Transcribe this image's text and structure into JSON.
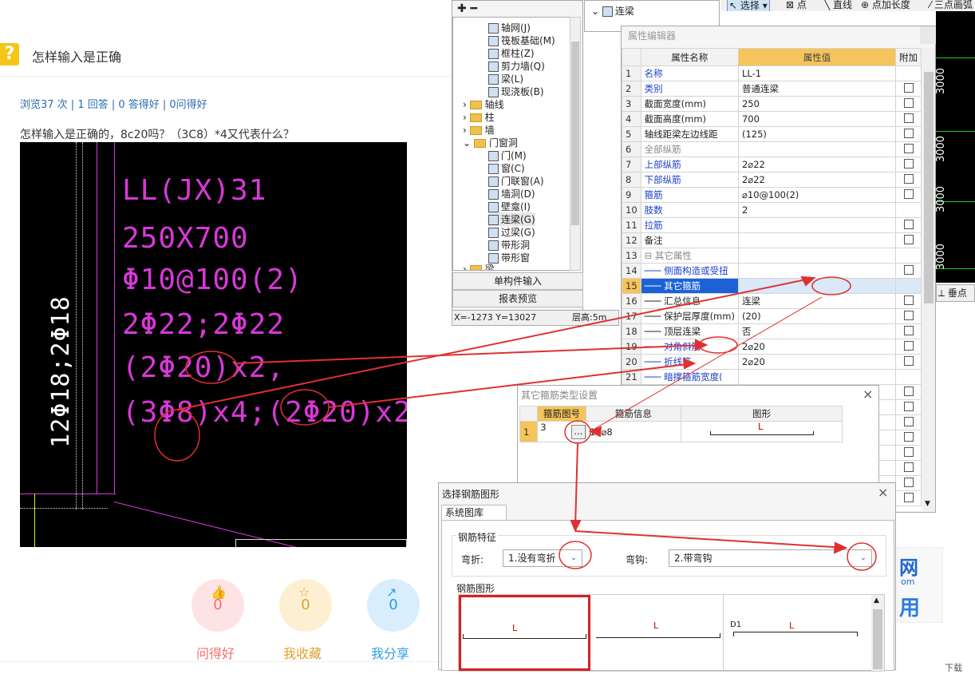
{
  "question": {
    "title": "怎样输入是正确",
    "stats": "浏览37 次 | 1 回答 | 0 答得好 | 0问得好",
    "text": "怎样输入是正确的，8c20吗？（3C8）*4又代表什么？",
    "actions": [
      {
        "count": "0",
        "label": "问得好",
        "color": "#f36f6f",
        "bg": "#fde3e3"
      },
      {
        "count": "0",
        "label": "我收藏",
        "color": "#e0a030",
        "bg": "#fdf0d2"
      },
      {
        "count": "0",
        "label": "我分享",
        "color": "#2b9de8",
        "bg": "#d8eefc"
      }
    ]
  },
  "cad": {
    "lines": [
      "LL(JX)31",
      "250X700",
      "Φ10@100(2)",
      "2Φ22;2Φ22",
      "(2Φ20)x2,",
      "(3Φ8)x4;(2Φ20)x2"
    ],
    "vertical": "12Φ18;2Φ18"
  },
  "tree": {
    "items": [
      "轴网(J)",
      "筏板基础(M)",
      "框柱(Z)",
      "剪力墙(Q)",
      "梁(L)",
      "现浇板(B)"
    ],
    "folders": [
      "轴线",
      "柱",
      "墙",
      "门窗洞"
    ],
    "sub": [
      "门(M)",
      "窗(C)",
      "门联窗(A)",
      "墙洞(D)",
      "壁龛(I)",
      "连梁(G)",
      "过梁(G)",
      "带形洞",
      "带形窗"
    ],
    "more": "梁",
    "btn1": "单构件输入",
    "btn2": "报表预览",
    "coord": "X=-1273 Y=13027",
    "floor": "层高:5m",
    "top_label": "连梁"
  },
  "toolbar": {
    "select": "选择",
    "point": "点",
    "line": "直线",
    "addlen": "点加长度",
    "arc": "三点画弧",
    "vert": "垂点"
  },
  "grid_labels": [
    "3000",
    "3000",
    "3000",
    "3000"
  ],
  "prop": {
    "title": "属性编辑器",
    "headers": [
      "属性名称",
      "属性值",
      "附加"
    ],
    "rows": [
      {
        "n": "1",
        "name": "名称",
        "val": "LL-1",
        "cls": "blue",
        "chk": false
      },
      {
        "n": "2",
        "name": "类别",
        "val": "普通连梁",
        "cls": "blue",
        "chk": true
      },
      {
        "n": "3",
        "name": "截面宽度(mm)",
        "val": "250",
        "cls": "",
        "chk": true
      },
      {
        "n": "4",
        "name": "截面高度(mm)",
        "val": "700",
        "cls": "",
        "chk": true
      },
      {
        "n": "5",
        "name": "轴线距梁左边线距",
        "val": "(125)",
        "cls": "",
        "chk": true
      },
      {
        "n": "6",
        "name": "全部纵筋",
        "val": "",
        "cls": "gray",
        "chk": true
      },
      {
        "n": "7",
        "name": "上部纵筋",
        "val": "2⌀22",
        "cls": "blue",
        "chk": true
      },
      {
        "n": "8",
        "name": "下部纵筋",
        "val": "2⌀22",
        "cls": "blue",
        "chk": true
      },
      {
        "n": "9",
        "name": "箍筋",
        "val": "⌀10@100(2)",
        "cls": "blue",
        "chk": true
      },
      {
        "n": "10",
        "name": "肢数",
        "val": "2",
        "cls": "blue",
        "chk": false
      },
      {
        "n": "11",
        "name": "拉筋",
        "val": "",
        "cls": "blue",
        "chk": true
      },
      {
        "n": "12",
        "name": "备注",
        "val": "",
        "cls": "",
        "chk": true
      },
      {
        "n": "13",
        "name": "其它属性",
        "val": "",
        "cls": "gray",
        "chk": false
      },
      {
        "n": "14",
        "name": "侧面构造或受扭",
        "val": "",
        "cls": "blue",
        "chk": true
      },
      {
        "n": "15",
        "name": "其它箍筋",
        "val": "",
        "cls": "",
        "chk": false
      },
      {
        "n": "16",
        "name": "汇总信息",
        "val": "连梁",
        "cls": "",
        "chk": true
      },
      {
        "n": "17",
        "name": "保护层厚度(mm)",
        "val": "(20)",
        "cls": "",
        "chk": true
      },
      {
        "n": "18",
        "name": "顶层连梁",
        "val": "否",
        "cls": "",
        "chk": true
      },
      {
        "n": "19",
        "name": "对角斜筋",
        "val": "2⌀20",
        "cls": "blue",
        "chk": true
      },
      {
        "n": "20",
        "name": "折线筋",
        "val": "2⌀20",
        "cls": "blue",
        "chk": true
      },
      {
        "n": "21",
        "name": "暗撑箍筋宽度(",
        "val": "",
        "cls": "blue",
        "chk": false
      }
    ]
  },
  "stirrup": {
    "title": "其它箍筋类型设置",
    "headers": [
      "箍筋图号",
      "箍筋信息",
      "图形"
    ],
    "row": {
      "n": "1",
      "code": "3",
      "info": "16⌀8",
      "shape": "L"
    },
    "ellipsis": "..."
  },
  "rebar": {
    "title": "选择钢筋图形",
    "tab": "系统图库",
    "group1": "钢筋特征",
    "bend_label": "弯折:",
    "bend_value": "1.没有弯折",
    "hook_label": "弯钩:",
    "hook_value": "2.带弯钩",
    "group2": "钢筋图形",
    "shapes": [
      "L",
      "L",
      "L"
    ],
    "d1": "D1"
  },
  "ad": {
    "txt1": "网",
    "txt2": "om",
    "txt3": "用"
  },
  "footer": {
    "download": "下载"
  }
}
